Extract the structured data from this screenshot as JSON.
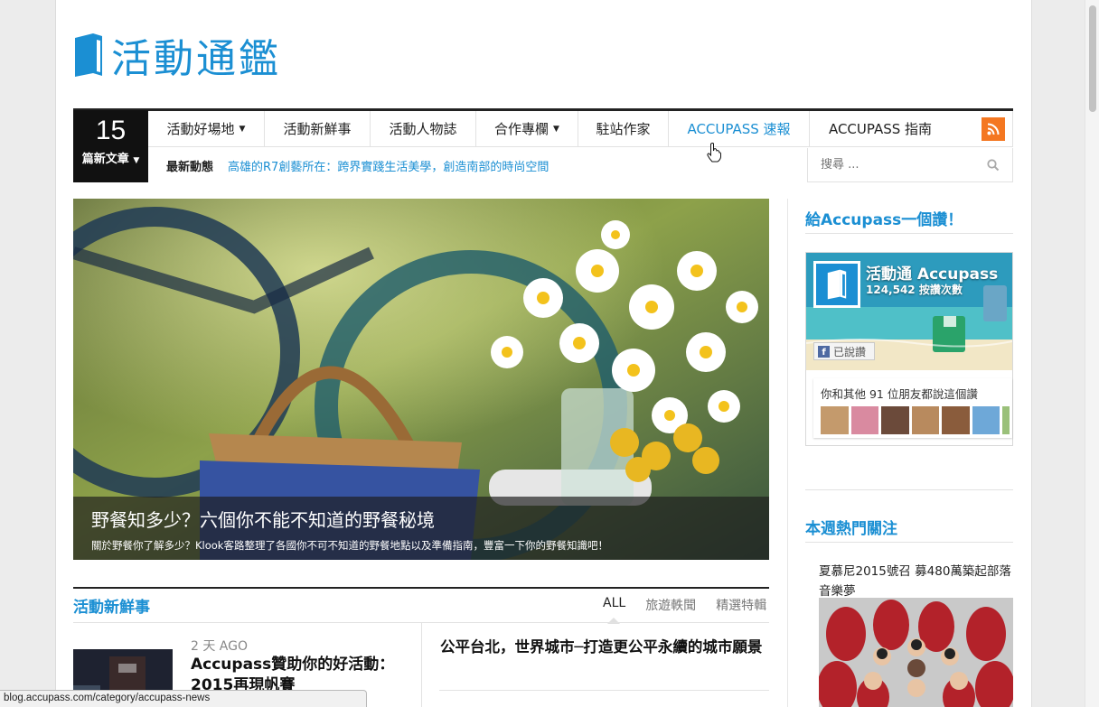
{
  "site": {
    "logo_text": "活動通鑑"
  },
  "nav": {
    "count": "15",
    "count_label": "篇新文章",
    "menu": [
      {
        "label": "活動好場地",
        "dropdown": true
      },
      {
        "label": "活動新鮮事",
        "dropdown": false
      },
      {
        "label": "活動人物誌",
        "dropdown": false
      },
      {
        "label": "合作專欄",
        "dropdown": true
      },
      {
        "label": "駐站作家",
        "dropdown": false
      },
      {
        "label": "ACCUPASS 速報",
        "dropdown": false
      },
      {
        "label": "ACCUPASS 指南",
        "dropdown": false
      }
    ],
    "ticker_label": "最新動態",
    "ticker_link": "高雄的R7創藝所在：跨界實踐生活美學，創造南部的時尚空間",
    "search_placeholder": "搜尋 ..."
  },
  "hero": {
    "title": "野餐知多少？六個你不能不知道的野餐秘境",
    "description": "關於野餐你了解多少？Klook客路整理了各國你不可不知道的野餐地點以及準備指南，豐富一下你的野餐知識吧！"
  },
  "sidebar": {
    "like_title": "給Accupass一個讚！",
    "fb": {
      "page_name": "活動通 Accupass",
      "likes": "124,542 按讚次數",
      "liked_label": "已說讚",
      "friends_text": "你和其他 91 位朋友都說這個讚"
    },
    "hot_title": "本週熱門關注",
    "hot_item": "夏慕尼2015號召 募480萬築起部落音樂夢"
  },
  "news": {
    "section_title": "活動新鮮事",
    "tabs": [
      "ALL",
      "旅遊軼聞",
      "精選特輯"
    ],
    "item1": {
      "date": "2 天 AGO",
      "headline": "Accupass贊助你的好活動：2015再現帆賽"
    },
    "item2": {
      "headline": "公平台北，世界城市─打造更公平永續的城市願景"
    }
  },
  "status": {
    "url": "blog.accupass.com/category/accupass-news"
  },
  "colors": {
    "brand_blue": "#1b8fd3",
    "rss_orange": "#f47721",
    "nav_dark": "#111111"
  }
}
